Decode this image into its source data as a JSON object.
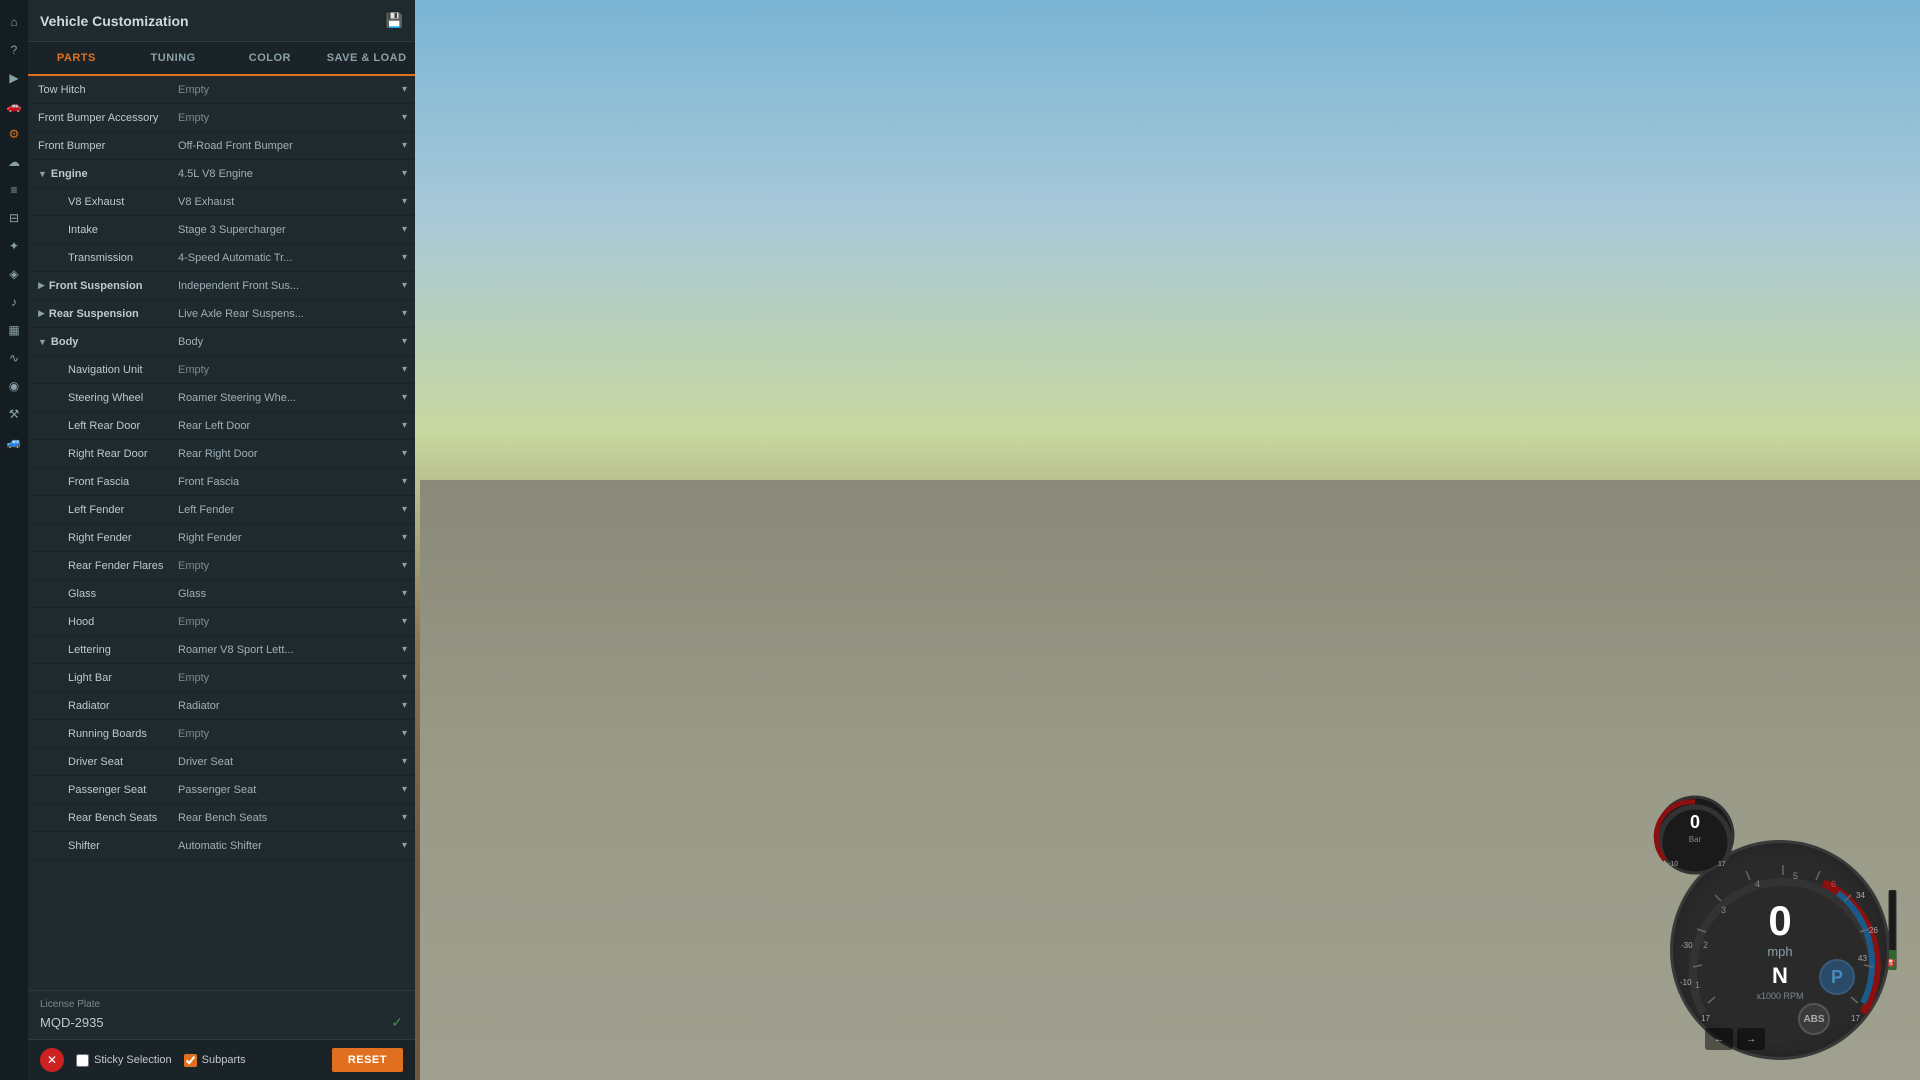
{
  "panel": {
    "title": "Vehicle Customization",
    "tabs": [
      "PARTS",
      "TUNING",
      "COLOR",
      "SAVE & LOAD"
    ],
    "active_tab": "PARTS"
  },
  "parts": [
    {
      "name": "Tow Hitch",
      "value": "Empty",
      "indent": 0,
      "expandable": false,
      "has_dropdown": true
    },
    {
      "name": "Front Bumper Accessory",
      "value": "Empty",
      "indent": 0,
      "expandable": false,
      "has_dropdown": true
    },
    {
      "name": "Front Bumper",
      "value": "Off-Road Front Bumper",
      "indent": 0,
      "expandable": false,
      "has_dropdown": true
    },
    {
      "name": "Engine",
      "value": "4.5L V8 Engine",
      "indent": 0,
      "expandable": true,
      "expanded": true,
      "has_dropdown": true
    },
    {
      "name": "V8 Exhaust",
      "value": "V8 Exhaust",
      "indent": 1,
      "expandable": false,
      "has_dropdown": true
    },
    {
      "name": "Intake",
      "value": "Stage 3 Supercharger",
      "indent": 1,
      "expandable": false,
      "has_dropdown": true
    },
    {
      "name": "Transmission",
      "value": "4-Speed Automatic Tr...",
      "indent": 1,
      "expandable": false,
      "has_dropdown": true
    },
    {
      "name": "Front Suspension",
      "value": "Independent Front Sus...",
      "indent": 0,
      "expandable": true,
      "expanded": false,
      "has_dropdown": true
    },
    {
      "name": "Rear Suspension",
      "value": "Live Axle Rear Suspens...",
      "indent": 0,
      "expandable": true,
      "expanded": false,
      "has_dropdown": true
    },
    {
      "name": "Body",
      "value": "Body",
      "indent": 0,
      "expandable": true,
      "expanded": true,
      "has_dropdown": true
    },
    {
      "name": "Navigation Unit",
      "value": "Empty",
      "indent": 1,
      "expandable": false,
      "has_dropdown": true
    },
    {
      "name": "Steering Wheel",
      "value": "Roamer Steering Whe...",
      "indent": 1,
      "expandable": false,
      "has_dropdown": true
    },
    {
      "name": "Left Rear Door",
      "value": "Rear Left Door",
      "indent": 1,
      "expandable": false,
      "has_dropdown": true
    },
    {
      "name": "Right Rear Door",
      "value": "Rear Right Door",
      "indent": 1,
      "expandable": false,
      "has_dropdown": true
    },
    {
      "name": "Front Fascia",
      "value": "Front Fascia",
      "indent": 1,
      "expandable": false,
      "has_dropdown": true
    },
    {
      "name": "Left Fender",
      "value": "Left Fender",
      "indent": 1,
      "expandable": false,
      "has_dropdown": true
    },
    {
      "name": "Right Fender",
      "value": "Right Fender",
      "indent": 1,
      "expandable": false,
      "has_dropdown": true
    },
    {
      "name": "Rear Fender Flares",
      "value": "Empty",
      "indent": 1,
      "expandable": false,
      "has_dropdown": true
    },
    {
      "name": "Glass",
      "value": "Glass",
      "indent": 1,
      "expandable": false,
      "has_dropdown": true
    },
    {
      "name": "Hood",
      "value": "Empty",
      "indent": 1,
      "expandable": false,
      "has_dropdown": true
    },
    {
      "name": "Lettering",
      "value": "Roamer V8 Sport Lett...",
      "indent": 1,
      "expandable": false,
      "has_dropdown": true
    },
    {
      "name": "Light Bar",
      "value": "Empty",
      "indent": 1,
      "expandable": false,
      "has_dropdown": true
    },
    {
      "name": "Radiator",
      "value": "Radiator",
      "indent": 1,
      "expandable": false,
      "has_dropdown": true
    },
    {
      "name": "Running Boards",
      "value": "Empty",
      "indent": 1,
      "expandable": false,
      "has_dropdown": true
    },
    {
      "name": "Driver Seat",
      "value": "Driver Seat",
      "indent": 1,
      "expandable": false,
      "has_dropdown": true
    },
    {
      "name": "Passenger Seat",
      "value": "Passenger Seat",
      "indent": 1,
      "expandable": false,
      "has_dropdown": true
    },
    {
      "name": "Rear Bench Seats",
      "value": "Rear Bench Seats",
      "indent": 1,
      "expandable": false,
      "has_dropdown": true
    },
    {
      "name": "Shifter",
      "value": "Automatic Shifter",
      "indent": 1,
      "expandable": false,
      "has_dropdown": true
    }
  ],
  "license_plate": {
    "label": "License Plate",
    "value": "MQD-2935"
  },
  "footer": {
    "sticky_label": "Sticky Selection",
    "subparts_label": "Subparts",
    "reset_label": "RESET"
  },
  "hud": {
    "speed": "0",
    "speed_unit": "mph",
    "gear": "N",
    "park": "P",
    "rpm_label": "x1000 RPM",
    "boost": "0",
    "boost_unit": "Bar",
    "abs_label": "ABS"
  },
  "icons": {
    "save": "💾",
    "expand": "▼",
    "collapse": "▶",
    "chevron_down": "▾",
    "check": "✓",
    "close": "✕",
    "arrow_left": "←",
    "arrow_right": "→"
  },
  "sidebar_icons": [
    {
      "name": "home",
      "symbol": "⌂",
      "active": false
    },
    {
      "name": "question",
      "symbol": "?",
      "active": false
    },
    {
      "name": "play",
      "symbol": "▶",
      "active": false
    },
    {
      "name": "car",
      "symbol": "🚗",
      "active": false
    },
    {
      "name": "settings-gear",
      "symbol": "⚙",
      "active": true
    },
    {
      "name": "cloud",
      "symbol": "☁",
      "active": false
    },
    {
      "name": "document",
      "symbol": "≡",
      "active": false
    },
    {
      "name": "sliders",
      "symbol": "⊟",
      "active": false
    },
    {
      "name": "nodes",
      "symbol": "✦",
      "active": false
    },
    {
      "name": "cog-small",
      "symbol": "◈",
      "active": false
    },
    {
      "name": "sound",
      "symbol": "♪",
      "active": false
    },
    {
      "name": "graph",
      "symbol": "▦",
      "active": false
    },
    {
      "name": "wave",
      "symbol": "∿",
      "active": false
    },
    {
      "name": "camera",
      "symbol": "◉",
      "active": false
    },
    {
      "name": "wrench",
      "symbol": "⚒",
      "active": false
    },
    {
      "name": "vehicle2",
      "symbol": "🚙",
      "active": false
    }
  ]
}
